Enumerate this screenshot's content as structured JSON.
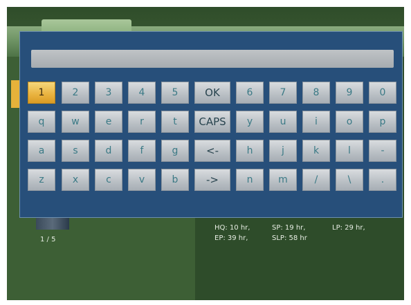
{
  "info": {
    "page_indicator": "1 / 5",
    "hq": "HQ: 10 hr,",
    "sp": "SP: 19 hr,",
    "lp": "LP: 29 hr,",
    "ep": "EP: 39 hr,",
    "slp": "SLP: 58 hr"
  },
  "keyboard": {
    "input_value": "",
    "rows": [
      [
        "1",
        "2",
        "3",
        "4",
        "5",
        "OK",
        "6",
        "7",
        "8",
        "9",
        "0"
      ],
      [
        "q",
        "w",
        "e",
        "r",
        "t",
        "CAPS",
        "y",
        "u",
        "i",
        "o",
        "p"
      ],
      [
        "a",
        "s",
        "d",
        "f",
        "g",
        "<-",
        "h",
        "j",
        "k",
        "l",
        "-"
      ],
      [
        "z",
        "x",
        "c",
        "v",
        "b",
        "->",
        "n",
        "m",
        "/",
        "\\",
        "."
      ]
    ],
    "selected_key": "1"
  },
  "colors": {
    "panel": "#274f7a",
    "key_text": "#3b7a86",
    "selected_key": "#e9b23e"
  }
}
